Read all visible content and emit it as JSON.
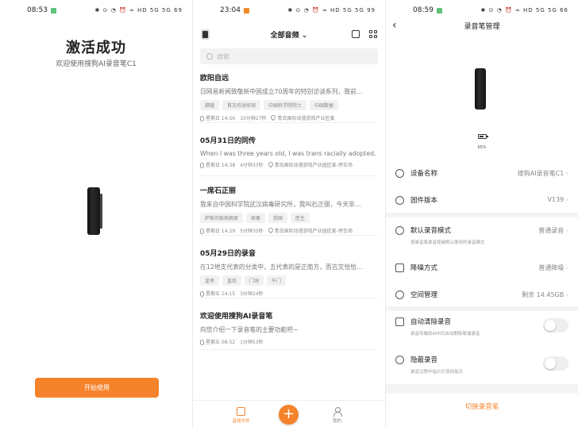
{
  "screen1": {
    "status_time": "08:53",
    "status_icons": "✱ ⊙ ◔ ⏰ ≈ HD 5G 5G 69",
    "title": "激活成功",
    "subtitle": "欢迎使用搜狗AI录音笔C1",
    "start_button": "开始使用"
  },
  "screen2": {
    "status_time": "23:04",
    "status_icons": "✱ ⊙ ◔ ⏰ ≈ HD 5G 5G 99",
    "header_title": "全部音频 ⌄",
    "search_placeholder": "搜索",
    "records": [
      {
        "title": "欧阳自远",
        "desc": "日网易新闻致敬新中国成立70周年的特别访谈系列，致前…",
        "tags": [
          "嫦娥",
          "首次月球探测",
          "中国科学院院士",
          "中国数据"
        ],
        "time": "星期日 14:56",
        "duration": "10分钟27秒",
        "location": "青岛国际动漫游戏产业区爱"
      },
      {
        "title": "05月31日的同传",
        "desc": "When I was three years old, I was trans racially adopted.",
        "tags": [],
        "time": "星期日 14:38",
        "duration": "4分钟33秒",
        "location": "青岛国际动漫游戏产业园区爱-停车场"
      },
      {
        "title": "一席石正丽",
        "desc": "我来自中国科学院武汉病毒研究所，我叫石正丽，今天非…",
        "tags": [
          "萨斯的致病病原",
          "病毒",
          "我国",
          "医生"
        ],
        "time": "星期日 14:29",
        "duration": "5分钟35秒",
        "location": "青岛国际动漫游戏产业园区爱-停车场"
      },
      {
        "title": "05月29日的录音",
        "desc": "在12地支代表的分类中，五代表的是正南方，而古文恰恰…",
        "tags": [
          "皇帝",
          "皇后",
          "门洞",
          "午门"
        ],
        "time": "星期五 14:15",
        "duration": "3分钟24秒",
        "location": ""
      },
      {
        "title": "欢迎使用搜狗AI录音笔",
        "desc": "向您介绍一下录音笔的主要功能吧~",
        "tags": [],
        "time": "星期五 08:52",
        "duration": "1分钟53秒",
        "location": ""
      }
    ],
    "nav": {
      "files": "音频文件",
      "me": "我的"
    },
    "fab_label": "+"
  },
  "screen3": {
    "status_time": "08:59",
    "status_icons": "✱ ⊙ ◔ ⏰ ≈ HD 5G 5G 66",
    "page_title": "录音笔管理",
    "battery_pct": "65%",
    "rows": {
      "device_name_label": "设备名称",
      "device_name_value": "搜狗AI录音笔C1",
      "firmware_label": "固件版本",
      "firmware_value": "V139",
      "mode_label": "默认录音模式",
      "mode_sub": "按录音笔录音按键默认使用的录音模式",
      "mode_value": "普通录音",
      "noise_label": "降噪方式",
      "noise_value": "普通降噪",
      "space_label": "空间管理",
      "space_value": "剩余 14.45GB",
      "autoclear_label": "自动清除录音",
      "autoclear_sub": "录音传输到APP后自动删除笔端录音",
      "hidden_label": "隐蔽录音",
      "hidden_sub": "录音过程中指示灯保持熄灭"
    },
    "switch_button": "切换录音笔"
  },
  "colors": {
    "accent": "#f5832b",
    "status_green": "#5ec27a"
  }
}
